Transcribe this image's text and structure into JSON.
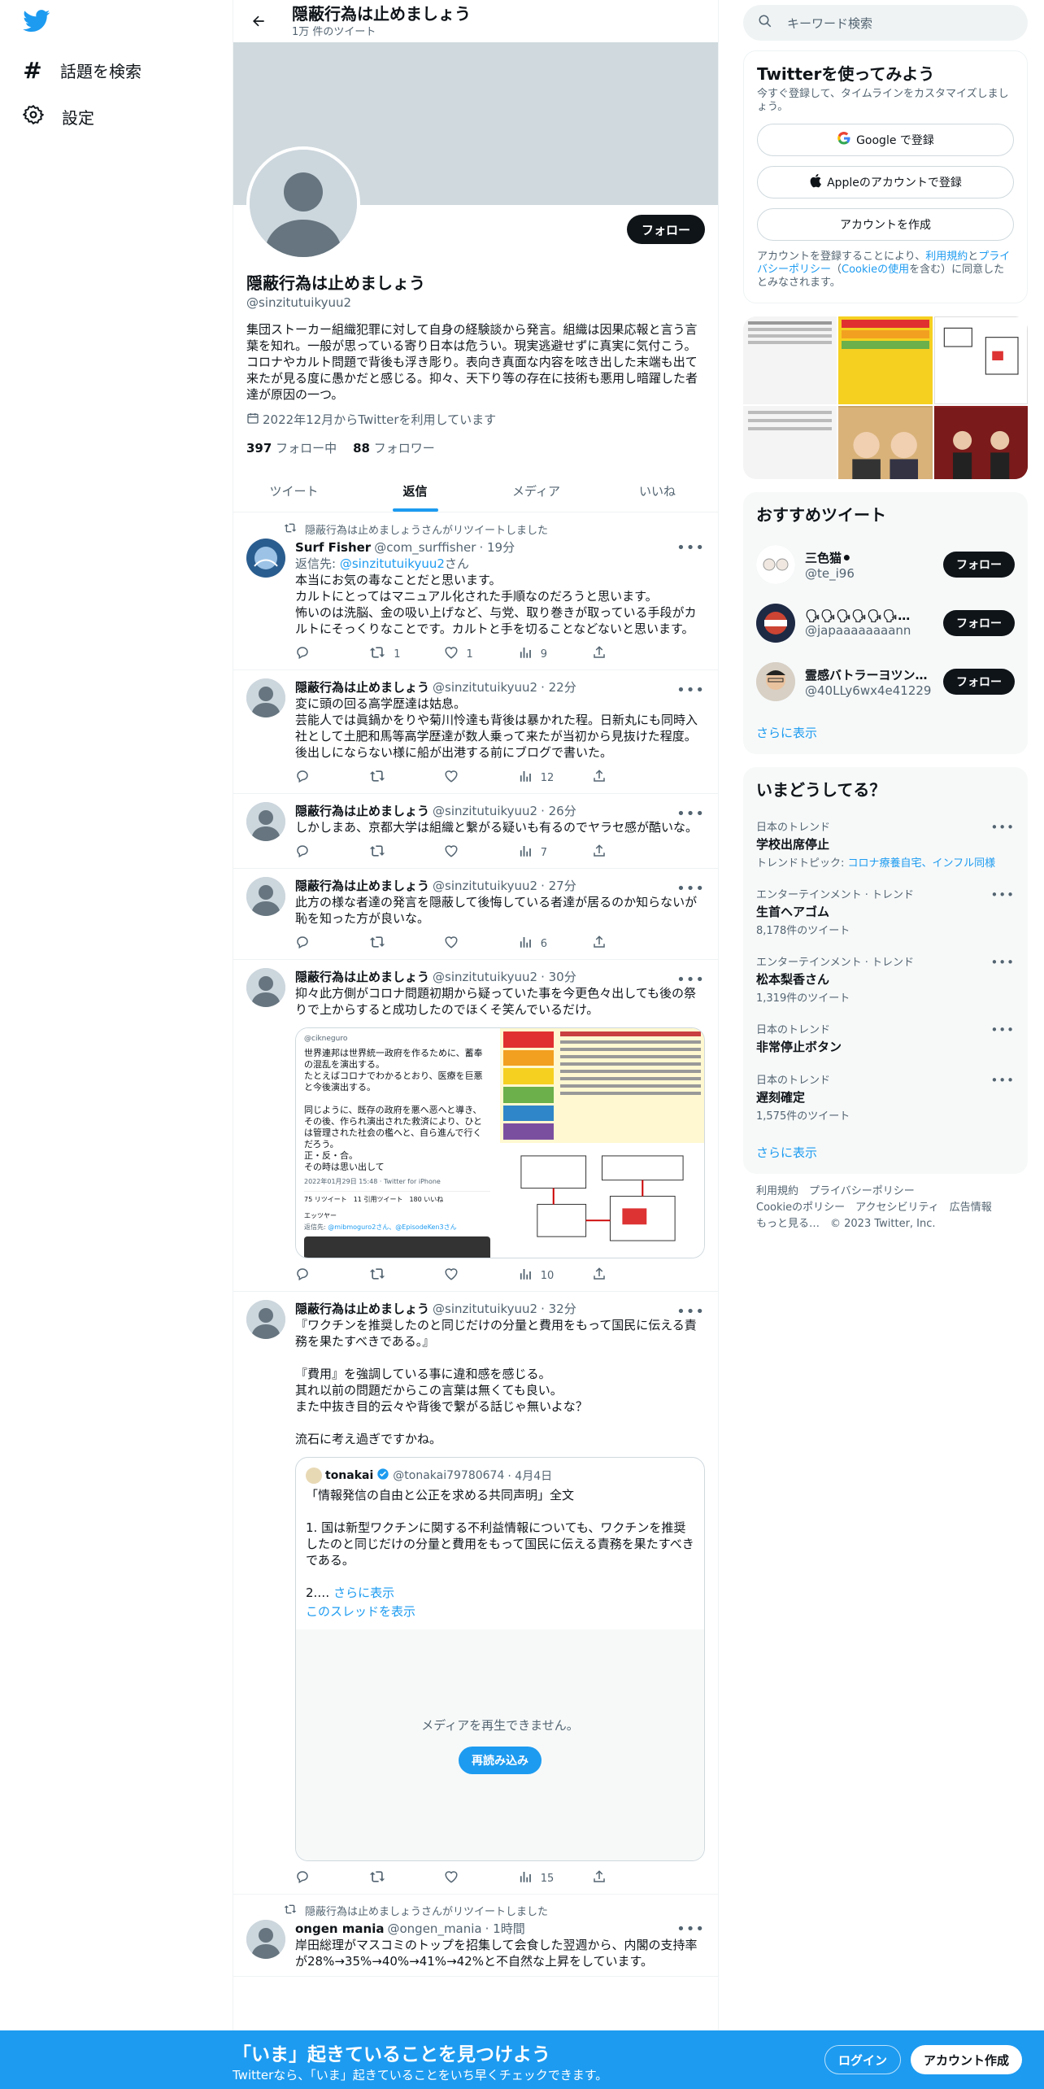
{
  "nav": {
    "items": [
      {
        "label": "話題を検索"
      },
      {
        "label": "設定"
      }
    ]
  },
  "header": {
    "title": "隠蔽行為は止めましょう",
    "subtitle": "1万 件のツイート"
  },
  "profile": {
    "name": "隠蔽行為は止めましょう",
    "handle": "@sinzitutuikyuu2",
    "bio": "集団ストーカー組織犯罪に対して自身の経験談から発言。組織は因果応報と言う言葉を知れ。一般が思っている寄り日本は危うい。現実逃避せずに真実に気付こう。コロナやカルト問題で背後も浮き彫り。表向き真面な内容を呟き出した末端も出て来たが見る度に愚かだと感じる。抑々、天下り等の存在に技術も悪用し暗躍した者達が原因の一つ。",
    "joined": "2022年12月からTwitterを利用しています",
    "following_count": "397",
    "following_label": "フォロー中",
    "followers_count": "88",
    "followers_label": "フォロワー",
    "follow_button": "フォロー"
  },
  "tabs": [
    "ツイート",
    "返信",
    "メディア",
    "いいね"
  ],
  "tweets": [
    {
      "retweeted_by": "隠蔽行為は止めましょうさんがリツイートしました",
      "name": "Surf Fisher",
      "handle": "@com_surffisher",
      "time": "· 19分",
      "reply_to_prefix": "返信先: ",
      "reply_to": "@sinzitutuikyuu2",
      "reply_to_suffix": "さん",
      "text": "本当にお気の毒なことだと思います。\nカルトにとってはマニュアル化された手順なのだろうと思います。\n怖いのは洗脳、金の吸い上げなど、与党、取り巻きが取っている手段がカルトにそっくりなことです。カルトと手を切ることなどないと思います。",
      "reply": "",
      "retweet": "1",
      "like": "1",
      "views": "9"
    },
    {
      "name": "隠蔽行為は止めましょう",
      "handle": "@sinzitutuikyuu2",
      "time": "· 22分",
      "text": "変に頭の回る高学歴達は姑息。\n芸能人では眞鍋かをりや菊川怜達も背後は暴かれた程。日新丸にも同時入社として土肥和馬等高学歴達が数人乗って来たが当初から見抜けた程度。後出しにならない様に船が出港する前にブログで書いた。",
      "views": "12"
    },
    {
      "name": "隠蔽行為は止めましょう",
      "handle": "@sinzitutuikyuu2",
      "time": "· 26分",
      "text": "しかしまあ、京都大学は組織と繋がる疑いも有るのでヤラセ感が酷いな。",
      "views": "7"
    },
    {
      "name": "隠蔽行為は止めましょう",
      "handle": "@sinzitutuikyuu2",
      "time": "· 27分",
      "text": "此方の様な者達の発言を隠蔽して後悔している者達が居るのか知らないが恥を知った方が良いな。",
      "views": "6"
    },
    {
      "name": "隠蔽行為は止めましょう",
      "handle": "@sinzitutuikyuu2",
      "time": "· 30分",
      "text": "抑々此方側がコロナ問題初期から疑っていた事を今更色々出しても後の祭りで上からすると成功したのでほくそ笑んでいるだけ。",
      "views": "10",
      "media_left_text": "世界連邦は世界統一政府を作るために、蓄奉の混乱を演出する。\nたとえばコロナでわかるとおり、医療を巨悪と今後演出する。\n\n同じように、既存の政府を悪へ恶へと導き、その後、作られ演出された救済により、ひとは管理された社会の檻へと、自ら進んで行くだろう。\n正・反・合。\nその時は思い出して",
      "media_left_meta": "2022年01月29日 15:48 · Twitter for iPhone",
      "media_left_stats": "75 リツイート　11 引用ツイート　180 いいね",
      "media_left_handle": "@cikneguro",
      "media_left_reply_user": "エッツヤー",
      "media_left_reply_prefix": "返信先: ",
      "media_left_reply_to": "@mibmoguro2さん、@EpisodeKen3さん"
    },
    {
      "name": "隠蔽行為は止めましょう",
      "handle": "@sinzitutuikyuu2",
      "time": "· 32分",
      "text": "『ワクチンを推奨したのと同じだけの分量と費用をもって国民に伝える責務を果たすべきである。』\n\n『費用』を強調している事に違和感を感じる。\n其れ以前の問題だからこの言葉は無くても良い。\nまた中抜き目的云々や背後で繋がる話じゃ無いよな？\n\n流石に考え過ぎですかね。",
      "views": "15",
      "quote": {
        "name": "tonakai",
        "handle": "@tonakai79780674",
        "time": "· 4月4日",
        "text": "「情報発信の自由と公正を求める共同声明」全文\n\n1. 国は新型ワクチンに関する不利益情報についても、ワクチンを推奨したのと同じだけの分量と費用をもって国民に伝える責務を果たすべきである。\n\n2.…",
        "more": " さらに表示",
        "thread": "このスレッドを表示",
        "media_error": "メディアを再生できません。",
        "reload": "再読み込み"
      }
    },
    {
      "retweeted_by": "隠蔽行為は止めましょうさんがリツイートしました",
      "name": "ongen mania",
      "handle": "@ongen_mania",
      "time": "· 1時間",
      "text": "岸田総理がマスコミのトップを招集して会食した翌週から、内閣の支持率が28%→35%→40%→41%→42%と不自然な上昇をしています。"
    }
  ],
  "right": {
    "search_placeholder": "キーワード検索",
    "signup": {
      "title": "Twitterを使ってみよう",
      "desc": "今すぐ登録して、タイムラインをカスタマイズしましょう。",
      "google": "Google で登録",
      "apple": "Appleのアカウントで登録",
      "create": "アカウントを作成",
      "terms_prefix": "アカウントを登録することにより、",
      "terms_link": "利用規約",
      "terms_and": "と",
      "privacy_link": "プライバシーポリシー",
      "terms_mid": "（",
      "cookie_link": "Cookieの使用",
      "terms_suffix": "を含む）に同意したとみなされます。"
    },
    "recommended": {
      "title": "おすすめツイート",
      "users": [
        {
          "name": "三色猫⚫",
          "handle": "@te_i96"
        },
        {
          "name": "🗣🗣🗣🗣🗣🗣…",
          "handle": "@japaaaaaaaann"
        },
        {
          "name": "霊感バトラーヨツン…",
          "handle": "@40LLy6wx4e41229"
        }
      ],
      "follow_label": "フォロー",
      "more": "さらに表示"
    },
    "trends": {
      "title": "いまどうしてる？",
      "items": [
        {
          "category": "日本のトレンド",
          "name": "学校出席停止",
          "topic_prefix": "トレンドトピック: ",
          "topic": "コロナ療養自宅、インフル同様"
        },
        {
          "category": "エンターテインメント · トレンド",
          "name": "生首ヘアゴム",
          "count": "8,178件のツイート"
        },
        {
          "category": "エンターテインメント · トレンド",
          "name": "松本梨香さん",
          "count": "1,319件のツイート"
        },
        {
          "category": "日本のトレンド",
          "name": "非常停止ボタン"
        },
        {
          "category": "日本のトレンド",
          "name": "遅刻確定",
          "count": "1,575件のツイート"
        }
      ],
      "more": "さらに表示"
    },
    "footer": {
      "l1": "利用規約　プライバシーポリシー",
      "l2": "Cookieのポリシー　アクセシビリティ　広告情報",
      "l3": "もっと見る…　© 2023 Twitter, Inc."
    }
  },
  "bottom": {
    "title": "「いま」起きていることを見つけよう",
    "subtitle": "Twitterなら、「いま」起きていることをいち早くチェックできます。",
    "login": "ログイン",
    "signup": "アカウント作成"
  },
  "colors": {
    "accent": "#1d9bf0",
    "text": "#0f1419",
    "secondary": "#536471"
  }
}
